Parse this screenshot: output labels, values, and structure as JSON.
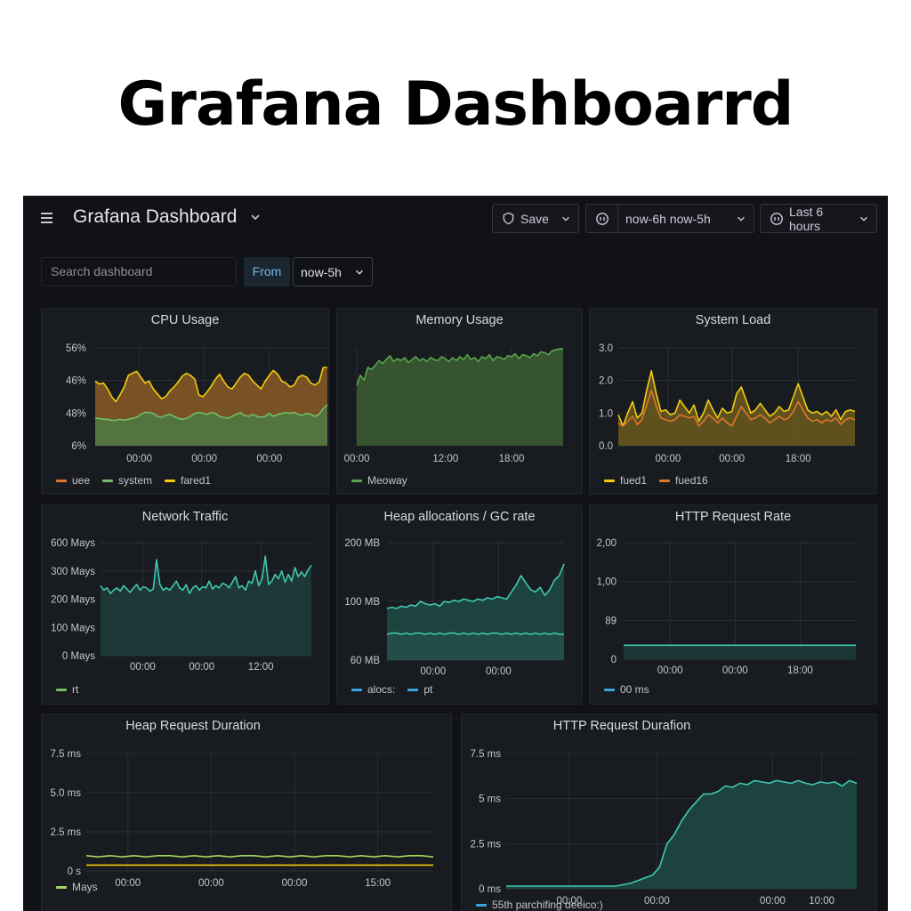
{
  "heading": "Grafana Dashboarrd",
  "topbar": {
    "title": "Grafana Dashboard",
    "save_label": "Save",
    "range_label": "now-6h now-5h",
    "last_label": "Last 6 hours"
  },
  "search": {
    "placeholder": "Search dashboard"
  },
  "filter": {
    "from_label": "From",
    "from_value": "now-5h"
  },
  "icons": {
    "menu": "hamburger-menu-icon",
    "save": "save-shield-icon",
    "range": "clock-icon",
    "last": "clock-icon",
    "chevron": "chevron-down-icon"
  },
  "colors": {
    "background": "#111217",
    "panel": "#181b1f",
    "orange": "#e0752d",
    "green": "#73bf69",
    "yellow": "#f2cc0c",
    "teal": "#3fc9b1",
    "blue": "#3ba5e0"
  },
  "panels": [
    {
      "id": "cpu",
      "title": "CPU Usage",
      "legend": [
        {
          "label": "uee",
          "color": "#e0752d"
        },
        {
          "label": "system",
          "color": "#73bf69"
        },
        {
          "label": "fared1",
          "color": "#f2cc0c"
        }
      ]
    },
    {
      "id": "memory",
      "title": "Memory Usage",
      "legend": [
        {
          "label": "Meoway",
          "color": "#56a64b"
        }
      ]
    },
    {
      "id": "load",
      "title": "System Load",
      "legend": [
        {
          "label": "fued1",
          "color": "#f2cc0c"
        },
        {
          "label": "fued16",
          "color": "#e0752d"
        }
      ]
    },
    {
      "id": "network",
      "title": "Network Traffic",
      "legend": [
        {
          "label": "rt",
          "color": "#73bf69"
        }
      ]
    },
    {
      "id": "heap",
      "title": "Heap allocations / GC rate",
      "legend": [
        {
          "label": "alocs:",
          "color": "#3ba5e0"
        },
        {
          "label": "pt",
          "color": "#3ba5e0"
        }
      ]
    },
    {
      "id": "http_rate",
      "title": "HTTP Request Rate",
      "legend": [
        {
          "label": "00 ms",
          "color": "#3ba5e0"
        }
      ]
    },
    {
      "id": "heap_dur",
      "title": "Heap Request Duration",
      "legend": [
        {
          "label": "Mays",
          "color": "#a4d65e"
        }
      ]
    },
    {
      "id": "http_dur",
      "title": "HTTP Request Durafion",
      "legend": [
        {
          "label": "55th parchifing deeico:)",
          "color": "#3ba5e0"
        }
      ]
    }
  ],
  "chart_data": [
    {
      "panel": "cpu",
      "type": "area",
      "y_ticks": [
        "56%",
        "46%",
        "48%",
        "6%"
      ],
      "x_ticks": [
        "00:00",
        "00:00",
        "00:00"
      ],
      "ylim": [
        0,
        1
      ],
      "series": [
        {
          "name": "fared1",
          "color": "#f2cc0c",
          "fill": "#8a5a26",
          "values": [
            0.66,
            0.63,
            0.64,
            0.58,
            0.5,
            0.45,
            0.52,
            0.6,
            0.72,
            0.74,
            0.76,
            0.7,
            0.64,
            0.66,
            0.58,
            0.53,
            0.48,
            0.5,
            0.56,
            0.6,
            0.65,
            0.71,
            0.74,
            0.72,
            0.68,
            0.52,
            0.5,
            0.55,
            0.61,
            0.68,
            0.73,
            0.66,
            0.6,
            0.58,
            0.64,
            0.7,
            0.74,
            0.72,
            0.66,
            0.62,
            0.58,
            0.66,
            0.72,
            0.77,
            0.73,
            0.66,
            0.64,
            0.6,
            0.62,
            0.7,
            0.72,
            0.7,
            0.64,
            0.62,
            0.65,
            0.8,
            0.8
          ]
        },
        {
          "name": "system",
          "color": "#73bf69",
          "fill": "#4e7a44",
          "values": [
            0.28,
            0.28,
            0.27,
            0.27,
            0.26,
            0.26,
            0.27,
            0.26,
            0.27,
            0.28,
            0.29,
            0.32,
            0.34,
            0.34,
            0.33,
            0.3,
            0.29,
            0.31,
            0.32,
            0.3,
            0.28,
            0.27,
            0.28,
            0.3,
            0.33,
            0.34,
            0.33,
            0.32,
            0.34,
            0.33,
            0.3,
            0.29,
            0.28,
            0.3,
            0.32,
            0.34,
            0.31,
            0.3,
            0.32,
            0.3,
            0.29,
            0.3,
            0.33,
            0.3,
            0.32,
            0.33,
            0.34,
            0.33,
            0.34,
            0.32,
            0.31,
            0.33,
            0.32,
            0.3,
            0.32,
            0.38,
            0.42
          ]
        }
      ]
    },
    {
      "panel": "memory",
      "type": "area",
      "x_ticks": [
        "00:00",
        "12:00",
        "18:00"
      ],
      "ylim": [
        0,
        1
      ],
      "series": [
        {
          "name": "Meoway",
          "color": "#56a64b",
          "fill": "#3d5e35",
          "values": [
            0.62,
            0.72,
            0.67,
            0.8,
            0.78,
            0.82,
            0.87,
            0.84,
            0.88,
            0.92,
            0.86,
            0.89,
            0.87,
            0.9,
            0.85,
            0.88,
            0.91,
            0.87,
            0.89,
            0.86,
            0.9,
            0.88,
            0.87,
            0.91,
            0.89,
            0.86,
            0.9,
            0.87,
            0.91,
            0.88,
            0.93,
            0.88,
            0.9,
            0.86,
            0.91,
            0.89,
            0.93,
            0.87,
            0.91,
            0.9,
            0.88,
            0.92,
            0.91,
            0.94,
            0.89,
            0.93,
            0.92,
            0.9,
            0.94,
            0.92,
            0.96,
            0.95,
            0.93,
            0.97,
            0.98,
            0.99,
            0.99
          ]
        }
      ]
    },
    {
      "panel": "load",
      "type": "line",
      "y_ticks": [
        "3.0",
        "2.0",
        "1.0",
        "0.0"
      ],
      "x_ticks": [
        "00:00",
        "00:00",
        "18:00"
      ],
      "ylim": [
        0,
        3
      ],
      "series": [
        {
          "name": "fued1",
          "color": "#f2cc0c",
          "fill": "#6b5a1f",
          "values": [
            0.95,
            0.6,
            1.0,
            1.35,
            0.85,
            1.0,
            1.7,
            2.3,
            1.6,
            1.05,
            1.1,
            0.95,
            1.0,
            1.4,
            1.2,
            1.0,
            1.25,
            0.75,
            1.0,
            1.4,
            1.1,
            0.85,
            1.15,
            1.0,
            1.05,
            1.6,
            1.8,
            1.4,
            1.0,
            1.1,
            1.3,
            1.1,
            0.9,
            1.0,
            1.2,
            1.05,
            1.1,
            1.5,
            1.9,
            1.5,
            1.1,
            1.0,
            1.05,
            0.95,
            1.05,
            0.9,
            1.1,
            0.8,
            1.05,
            1.1,
            1.05
          ]
        },
        {
          "name": "fued16",
          "color": "#e0752d",
          "fill": "none",
          "values": [
            0.7,
            0.6,
            0.75,
            0.9,
            0.65,
            0.8,
            1.25,
            1.7,
            1.2,
            0.85,
            0.8,
            0.75,
            0.8,
            0.95,
            0.9,
            0.85,
            0.9,
            0.6,
            0.75,
            0.95,
            0.85,
            0.7,
            0.85,
            0.7,
            0.6,
            0.9,
            1.2,
            1.0,
            0.8,
            0.85,
            0.95,
            0.85,
            0.7,
            0.8,
            0.9,
            0.8,
            0.85,
            1.05,
            1.35,
            1.1,
            0.85,
            0.75,
            0.8,
            0.7,
            0.8,
            0.75,
            0.85,
            0.65,
            0.8,
            0.85,
            0.8
          ]
        }
      ]
    },
    {
      "panel": "network",
      "type": "area",
      "y_ticks": [
        "600 Mays",
        "300 Mays",
        "200 Mays",
        "100 Mays",
        "0 Mays"
      ],
      "x_ticks": [
        "00:00",
        "00:00",
        "12:00"
      ],
      "ylim": [
        0,
        1
      ],
      "series": [
        {
          "name": "rt",
          "color": "#3fc9b1",
          "fill": "#1f3d3b",
          "values": [
            0.62,
            0.58,
            0.6,
            0.55,
            0.58,
            0.6,
            0.57,
            0.62,
            0.59,
            0.56,
            0.6,
            0.63,
            0.58,
            0.61,
            0.6,
            0.57,
            0.59,
            0.85,
            0.63,
            0.58,
            0.6,
            0.58,
            0.62,
            0.66,
            0.6,
            0.58,
            0.63,
            0.55,
            0.6,
            0.62,
            0.58,
            0.61,
            0.6,
            0.66,
            0.59,
            0.62,
            0.6,
            0.64,
            0.63,
            0.6,
            0.65,
            0.7,
            0.6,
            0.62,
            0.58,
            0.66,
            0.64,
            0.75,
            0.62,
            0.68,
            0.88,
            0.63,
            0.66,
            0.72,
            0.68,
            0.75,
            0.65,
            0.72,
            0.66,
            0.78,
            0.7,
            0.74,
            0.7,
            0.76,
            0.8
          ]
        }
      ]
    },
    {
      "panel": "heap",
      "type": "area",
      "y_ticks": [
        "200 MB",
        "100 MB",
        "60 MB"
      ],
      "x_ticks": [
        "00:00",
        "00:00"
      ],
      "ylim": [
        0,
        1
      ],
      "series": [
        {
          "name": "alocs:",
          "color": "#3fc9b1",
          "fill": "#1f4a45",
          "values": [
            0.44,
            0.45,
            0.44,
            0.46,
            0.45,
            0.47,
            0.46,
            0.5,
            0.48,
            0.47,
            0.48,
            0.46,
            0.5,
            0.49,
            0.51,
            0.5,
            0.52,
            0.51,
            0.5,
            0.52,
            0.51,
            0.53,
            0.52,
            0.54,
            0.53,
            0.52,
            0.58,
            0.64,
            0.72,
            0.66,
            0.6,
            0.58,
            0.62,
            0.55,
            0.6,
            0.68,
            0.72,
            0.82
          ]
        },
        {
          "name": "pt",
          "color": "#3fc9b1",
          "fill": "#244f4b",
          "values": [
            0.22,
            0.23,
            0.23,
            0.22,
            0.23,
            0.22,
            0.23,
            0.23,
            0.22,
            0.23,
            0.22,
            0.23,
            0.22,
            0.23,
            0.23,
            0.22,
            0.23,
            0.22,
            0.23,
            0.22,
            0.23,
            0.22,
            0.23,
            0.23,
            0.22,
            0.23,
            0.22,
            0.23,
            0.22,
            0.23,
            0.22,
            0.23,
            0.22,
            0.23,
            0.22,
            0.23,
            0.22,
            0.22
          ]
        }
      ]
    },
    {
      "panel": "http_rate",
      "type": "area",
      "y_ticks": [
        "2,00",
        "1,00",
        "89",
        "0"
      ],
      "x_ticks": [
        "00:00",
        "00:00",
        "18:00"
      ],
      "ylim": [
        0,
        1
      ],
      "series": [
        {
          "name": "00 ms",
          "color": "#3fc9b1",
          "fill": "#1c3b38",
          "values": [
            0.12,
            0.12,
            0.12,
            0.12,
            0.12,
            0.12,
            0.12,
            0.12,
            0.12,
            0.12,
            0.12,
            0.12,
            0.12,
            0.12,
            0.12,
            0.12,
            0.12,
            0.12,
            0.12,
            0.12
          ]
        }
      ]
    },
    {
      "panel": "heap_dur",
      "type": "line",
      "y_ticks": [
        "7.5 ms",
        "5.0 ms",
        "2.5 ms",
        "0 s"
      ],
      "x_ticks": [
        "00:00",
        "00:00",
        "00:00",
        "15:00"
      ],
      "ylim": [
        0,
        1
      ],
      "series": [
        {
          "name": "Mays",
          "color": "#a4d65e",
          "fill": "none",
          "values": [
            0.13,
            0.12,
            0.13,
            0.12,
            0.13,
            0.12,
            0.13,
            0.13,
            0.12,
            0.13,
            0.12,
            0.13,
            0.12,
            0.13,
            0.13,
            0.12,
            0.13,
            0.12,
            0.13,
            0.12,
            0.13,
            0.13,
            0.12,
            0.13,
            0.12,
            0.13,
            0.12,
            0.13,
            0.13,
            0.12
          ]
        },
        {
          "name": "",
          "color": "#f2cc0c",
          "fill": "none",
          "values": [
            0.05,
            0.05,
            0.05,
            0.05,
            0.05,
            0.05,
            0.05,
            0.05,
            0.05,
            0.05,
            0.05,
            0.05,
            0.05,
            0.05,
            0.05,
            0.05,
            0.05,
            0.05,
            0.05,
            0.05,
            0.05,
            0.05,
            0.05,
            0.05,
            0.05,
            0.05,
            0.05,
            0.05,
            0.05,
            0.05
          ]
        }
      ]
    },
    {
      "panel": "http_dur",
      "type": "area",
      "y_ticks": [
        "7.5 ms",
        "5 ms",
        "2.5 ms",
        "0 ms"
      ],
      "x_ticks": [
        "00:00",
        "00:00",
        "00:00",
        "10:00"
      ],
      "ylim": [
        0,
        1
      ],
      "series": [
        {
          "name": "55th parchifing deeico:)",
          "color": "#3fc9b1",
          "fill": "#1f4a45",
          "values": [
            0.02,
            0.02,
            0.02,
            0.02,
            0.02,
            0.02,
            0.02,
            0.02,
            0.02,
            0.02,
            0.02,
            0.02,
            0.02,
            0.02,
            0.02,
            0.02,
            0.03,
            0.04,
            0.06,
            0.08,
            0.1,
            0.16,
            0.33,
            0.4,
            0.5,
            0.58,
            0.64,
            0.7,
            0.7,
            0.72,
            0.76,
            0.75,
            0.78,
            0.77,
            0.8,
            0.79,
            0.78,
            0.8,
            0.79,
            0.78,
            0.8,
            0.78,
            0.77,
            0.79,
            0.78,
            0.79,
            0.76,
            0.8,
            0.78
          ]
        }
      ]
    }
  ]
}
